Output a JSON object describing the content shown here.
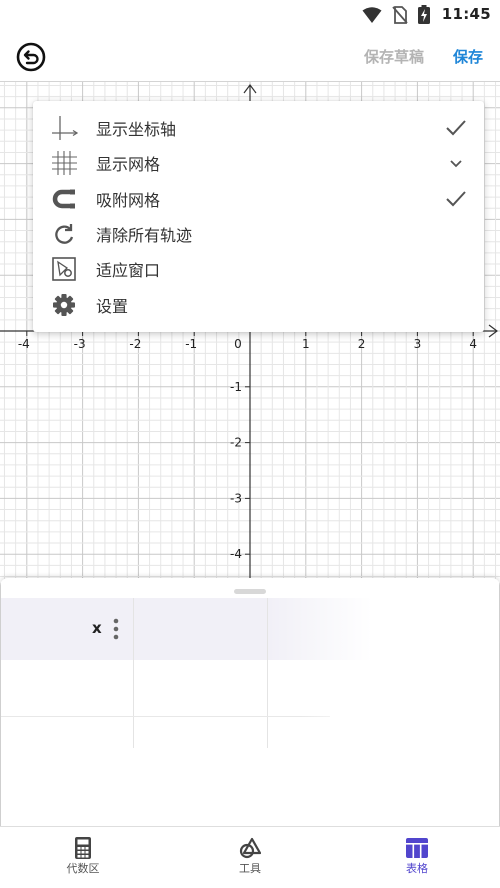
{
  "status_bar": {
    "time": "11:45"
  },
  "toolbar": {
    "save_draft_label": "保存草稿",
    "save_label": "保存"
  },
  "colors": {
    "accent": "#1f86d8",
    "active_tab": "#5145cd",
    "disabled_text": "#b4b4b4"
  },
  "graph": {
    "x_ticks": [
      "-4",
      "-3",
      "-2",
      "-1",
      "0",
      "1",
      "2",
      "3",
      "4"
    ],
    "y_ticks": [
      "-1",
      "-2",
      "-3",
      "-4"
    ],
    "origin_label": "0"
  },
  "menu": {
    "items": [
      {
        "label": "显示坐标轴",
        "icon": "axes-icon",
        "checked": true
      },
      {
        "label": "显示网格",
        "icon": "grid-icon",
        "checked": false,
        "expandable": true
      },
      {
        "label": "吸附网格",
        "icon": "magnet-icon",
        "checked": true
      },
      {
        "label": "清除所有轨迹",
        "icon": "refresh-icon",
        "checked": false
      },
      {
        "label": "适应窗口",
        "icon": "zoom-to-fit-icon",
        "checked": false
      },
      {
        "label": "设置",
        "icon": "gear-icon",
        "checked": false
      }
    ]
  },
  "table": {
    "column_header": "x"
  },
  "bottom_nav": {
    "items": [
      {
        "label": "代数区",
        "icon": "calculator-icon",
        "active": false
      },
      {
        "label": "工具",
        "icon": "tools-icon",
        "active": false
      },
      {
        "label": "表格",
        "icon": "table-icon",
        "active": true
      }
    ]
  }
}
